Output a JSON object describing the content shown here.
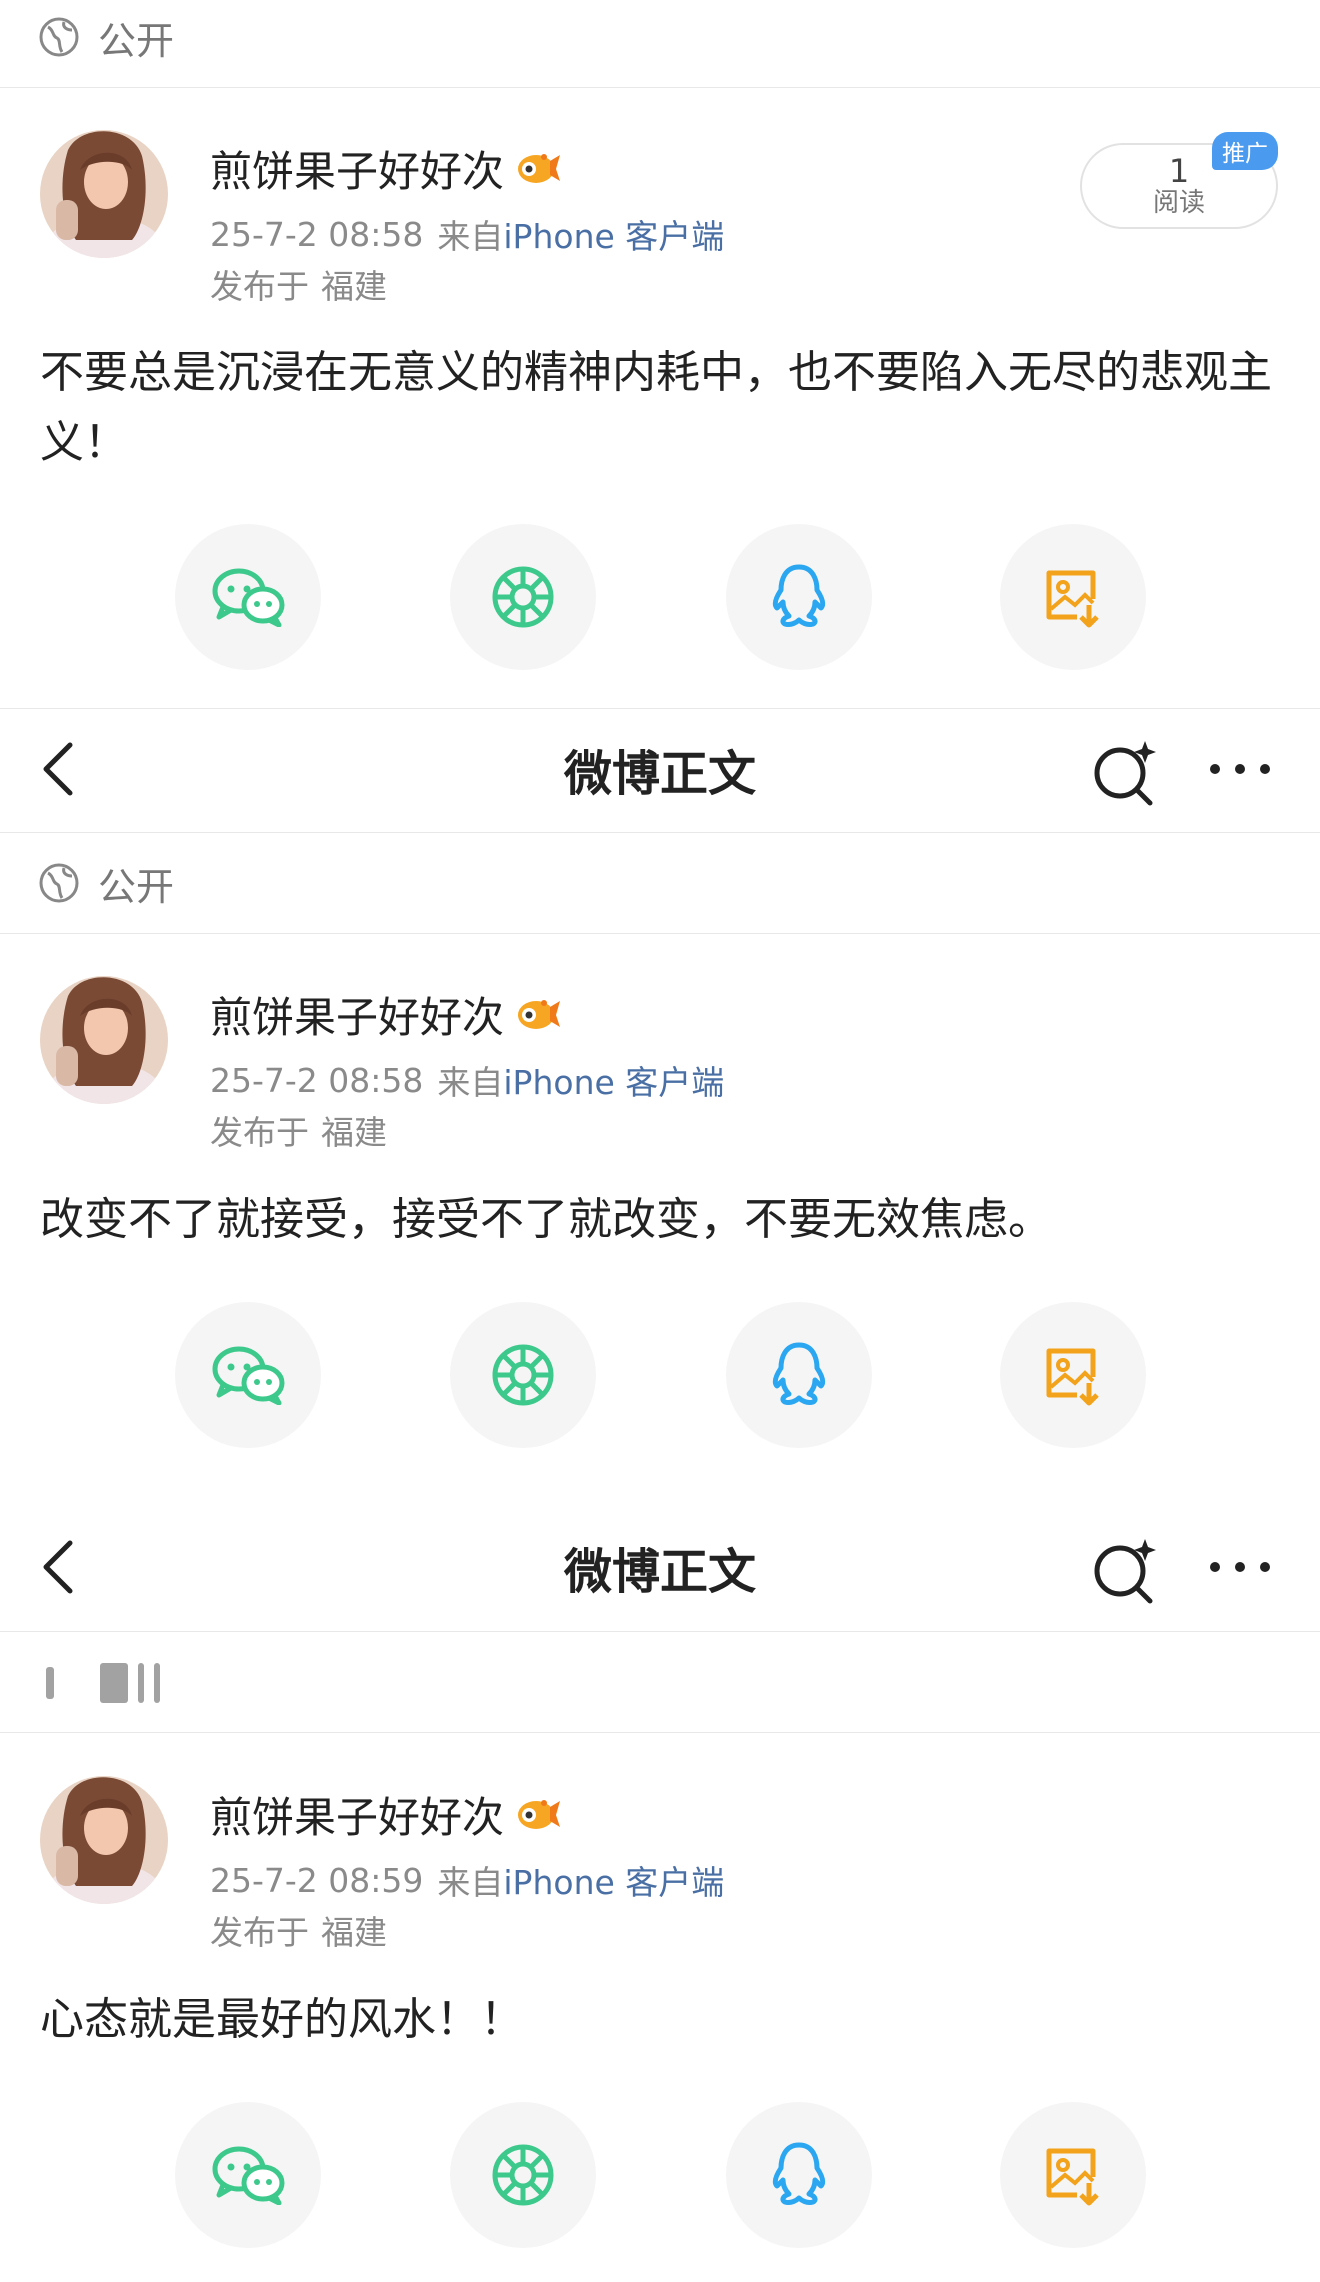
{
  "nav": {
    "title": "微博正文"
  },
  "posts": [
    {
      "privacy": "公开",
      "user_name": "煎饼果子好好次",
      "time": "25-7-2 08:58",
      "from_prefix": "来自",
      "source": "iPhone 客户端",
      "location_prefix": "发布于",
      "location": "福建",
      "text": "不要总是沉浸在无意义的精神内耗中，也不要陷入无尽的悲观主义！",
      "reads_count": "1",
      "reads_label": "阅读",
      "promo_tag": "推广"
    },
    {
      "privacy": "公开",
      "user_name": "煎饼果子好好次",
      "time": "25-7-2 08:58",
      "from_prefix": "来自",
      "source": "iPhone 客户端",
      "location_prefix": "发布于",
      "location": "福建",
      "text": "改变不了就接受，接受不了就改变，不要无效焦虑。"
    },
    {
      "user_name": "煎饼果子好好次",
      "time": "25-7-2 08:59",
      "from_prefix": "来自",
      "source": "iPhone 客户端",
      "location_prefix": "发布于",
      "location": "福建",
      "text": "心态就是最好的风水！！"
    }
  ],
  "share_icons": [
    "wechat-icon",
    "moments-icon",
    "qq-icon",
    "save-image-icon"
  ],
  "colors": {
    "wechat": "#3cc98b",
    "moments": "#3cc98b",
    "qq": "#2aa7f0",
    "save_image": "#f2a31b",
    "source_link": "#4a6fa5",
    "promo": "#4a9bf0"
  }
}
